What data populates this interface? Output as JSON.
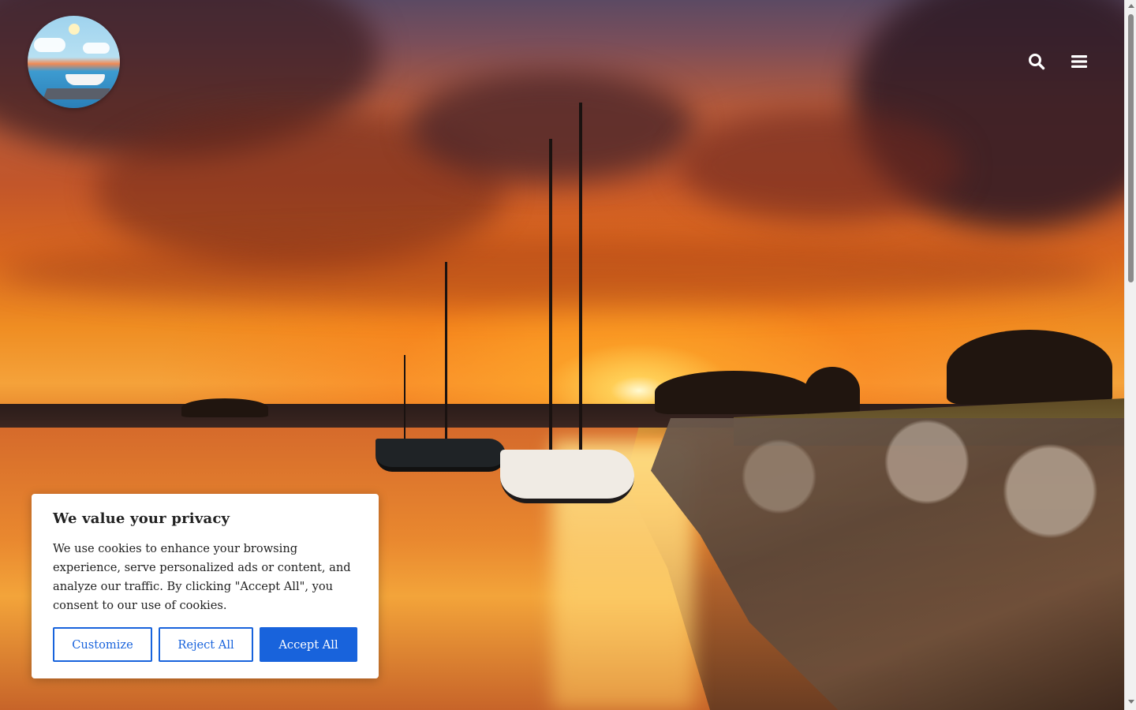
{
  "site": {
    "logo_alt": "harbor-logo",
    "header_icons": [
      "search-icon",
      "menu-icon"
    ]
  },
  "cookie_banner": {
    "title": "We value your privacy",
    "text": "We use cookies to enhance your browsing experience, serve personalized ads or content, and analyze our traffic. By clicking \"Accept All\", you consent to our use of cookies.",
    "buttons": {
      "customize": "Customize",
      "reject": "Reject All",
      "accept": "Accept All"
    }
  },
  "colors": {
    "accent": "#1863dc",
    "banner_bg": "#ffffff",
    "text": "#212121"
  }
}
